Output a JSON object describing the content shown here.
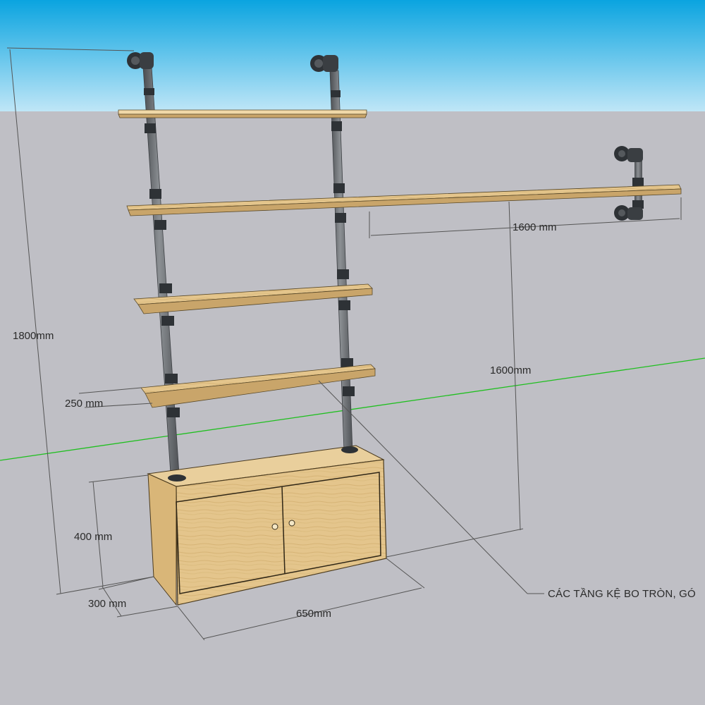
{
  "dimensions": {
    "total_height": "1800mm",
    "long_shelf_length": "1600 mm",
    "long_shelf_height": "1600mm",
    "shelf_depth": "250 mm",
    "cabinet_height": "400 mm",
    "cabinet_depth": "300 mm",
    "cabinet_width": "650mm"
  },
  "annotation": {
    "note": "CÁC TẦNG KỆ BO TRÒN, GÓ"
  },
  "colors": {
    "sky_top": "#0aa4e0",
    "sky_bottom": "#b9e4f6",
    "ground": "#bfbfc5",
    "wood": "#e2c38a",
    "pipe": "#6b6e72",
    "fitting": "#2e3236",
    "axis_line": "#1fbf1f"
  }
}
